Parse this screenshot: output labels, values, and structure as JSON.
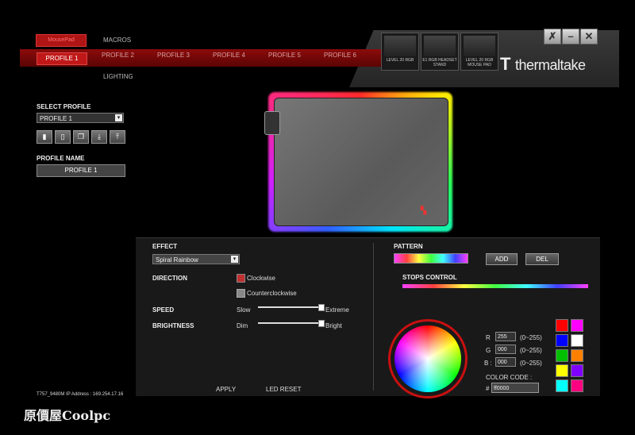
{
  "header": {
    "device_tab": "MousePad",
    "nav_top": "MACROS",
    "nav_bottom": "LIGHTING",
    "profiles": [
      "PROFILE 1",
      "PROFILE 2",
      "PROFILE 3",
      "PROFILE 4",
      "PROFILE 5",
      "PROFILE 6"
    ],
    "thumbnails": [
      "LEVEL 20 RGB",
      "E1 RGB HEADSET STAND",
      "LEVEL 20 RGB MOUSE PAD"
    ],
    "brand": "thermaltake",
    "brand_mark": "T"
  },
  "left": {
    "select_label": "SELECT PROFILE",
    "select_value": "PROFILE 1",
    "profile_name_label": "PROFILE NAME",
    "profile_name_value": "PROFILE 1",
    "ip_address": "T757_9480M IP Address : 169.254.17.16"
  },
  "effect": {
    "label": "EFFECT",
    "value": "Spiral Rainbow",
    "direction_label": "DIRECTION",
    "clockwise": "Clockwise",
    "counterclockwise": "Counterclockwise",
    "speed_label": "SPEED",
    "speed_min": "Slow",
    "speed_max": "Extreme",
    "speed_value": 1.0,
    "brightness_label": "BRIGHTNESS",
    "brightness_min": "Dim",
    "brightness_max": "Bright",
    "brightness_value": 1.0,
    "apply": "APPLY",
    "led_reset": "LED RESET"
  },
  "pattern": {
    "label": "PATTERN",
    "add": "ADD",
    "del": "DEL",
    "stops_label": "STOPS CONTROL",
    "r_label": "R",
    "g_label": "G",
    "b_label": "B :",
    "r_value": "255",
    "g_value": "000",
    "b_value": "000",
    "range": "(0~255)",
    "color_code_label": "COLOR CODE :",
    "hash": "#",
    "color_code_value": "ff0000",
    "swatches": [
      "#ff0000",
      "#ff00ff",
      "#0000ff",
      "#ffffff",
      "#00c000",
      "#ff8000",
      "#ffff00",
      "#8000ff",
      "#00ffff",
      "#ff0080"
    ]
  },
  "watermark": "原價屋Coolpc"
}
